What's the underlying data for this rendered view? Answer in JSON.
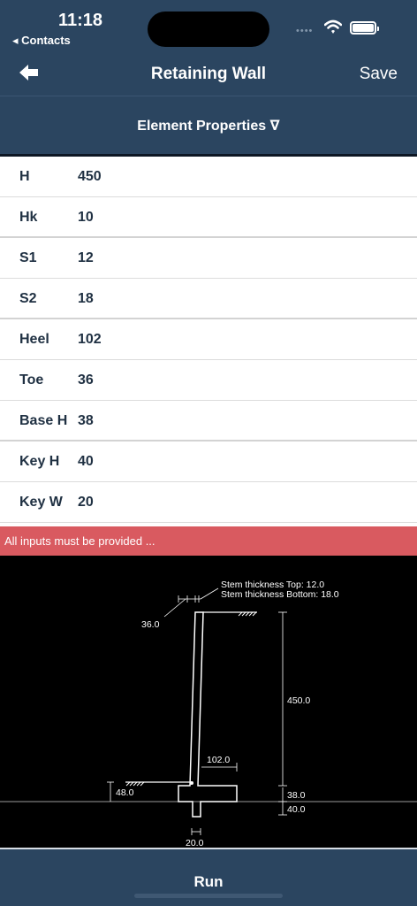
{
  "status": {
    "time": "11:18",
    "back_app": "◂ Contacts",
    "signal": "••••"
  },
  "nav": {
    "title": "Retaining Wall",
    "save": "Save"
  },
  "segment": {
    "label": "Element Properties ∇"
  },
  "properties": [
    {
      "label": "H",
      "value": "450"
    },
    {
      "label": "Hk",
      "value": "10"
    },
    {
      "label": "S1",
      "value": "12"
    },
    {
      "label": "S2",
      "value": "18"
    },
    {
      "label": "Heel",
      "value": "102"
    },
    {
      "label": "Toe",
      "value": "36"
    },
    {
      "label": "Base H",
      "value": "38"
    },
    {
      "label": "Key H",
      "value": "40"
    },
    {
      "label": "Key W",
      "value": "20"
    }
  ],
  "error": {
    "message": "All inputs must be provided ..."
  },
  "drawing": {
    "stem_top": "Stem thickness Top: 12.0",
    "stem_bottom": "Stem thickness Bottom: 18.0",
    "toe_dim": "36.0",
    "height_dim": "450.0",
    "heel_dim": "102.0",
    "soil_dim": "48.0",
    "base_dim": "38.0",
    "key_h_dim": "40.0",
    "key_w_dim": "20.0"
  },
  "run": {
    "label": "Run"
  }
}
